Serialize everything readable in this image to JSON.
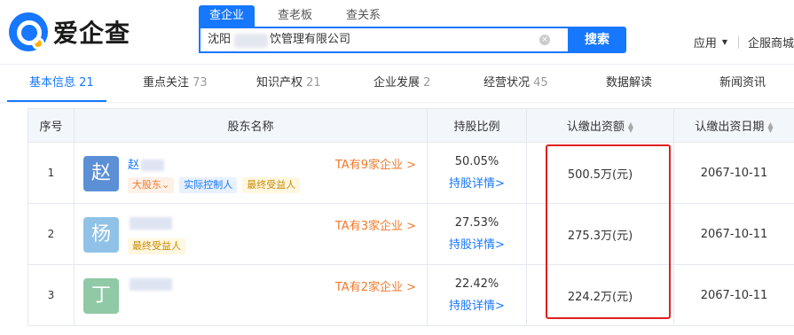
{
  "brand": {
    "name": "爱企查"
  },
  "search": {
    "tabs": [
      "查企业",
      "查老板",
      "查关系"
    ],
    "value_prefix": "沈阳",
    "value_suffix": "饮管理有限公司",
    "clear_glyph": "×",
    "button": "搜索"
  },
  "topbar": {
    "apps": "应用",
    "biz": "企服商城"
  },
  "nav": [
    {
      "label": "基本信息",
      "count": "21"
    },
    {
      "label": "重点关注",
      "count": "73"
    },
    {
      "label": "知识产权",
      "count": "21"
    },
    {
      "label": "企业发展",
      "count": "2"
    },
    {
      "label": "经营状况",
      "count": "45"
    },
    {
      "label": "数据解读",
      "count": ""
    },
    {
      "label": "新闻资讯",
      "count": ""
    }
  ],
  "table": {
    "headers": {
      "index": "序号",
      "name": "股东名称",
      "ratio": "持股比例",
      "amount": "认缴出资额",
      "date": "认缴出资日期"
    },
    "rows": [
      {
        "index": "1",
        "avatar": "赵",
        "avatar_color": "#5b8fd6",
        "name": "赵",
        "ta": "TA有9家企业 >",
        "tags": [
          {
            "label": "大股东",
            "kind": "big",
            "suffix": "⌄"
          },
          {
            "label": "实际控制人",
            "kind": "ctrl",
            "suffix": ""
          },
          {
            "label": "最终受益人",
            "kind": "ben",
            "suffix": ""
          }
        ],
        "ratio": "50.05%",
        "detail": "持股详情>",
        "amount": "500.5万(元)",
        "date": "2067-10-11"
      },
      {
        "index": "2",
        "avatar": "杨",
        "avatar_color": "#8fc2e6",
        "name": "",
        "ta": "TA有3家企业 >",
        "tags": [
          {
            "label": "最终受益人",
            "kind": "ben",
            "suffix": ""
          }
        ],
        "ratio": "27.53%",
        "detail": "持股详情>",
        "amount": "275.3万(元)",
        "date": "2067-10-11"
      },
      {
        "index": "3",
        "avatar": "丁",
        "avatar_color": "#8fc9a6",
        "name": "",
        "ta": "TA有2家企业 >",
        "tags": [],
        "ratio": "22.42%",
        "detail": "持股详情>",
        "amount": "224.2万(元)",
        "date": "2067-10-11"
      }
    ]
  },
  "colors": {
    "accent": "#1677ff",
    "orange": "#f07a2b",
    "highlight": "#e02020"
  }
}
